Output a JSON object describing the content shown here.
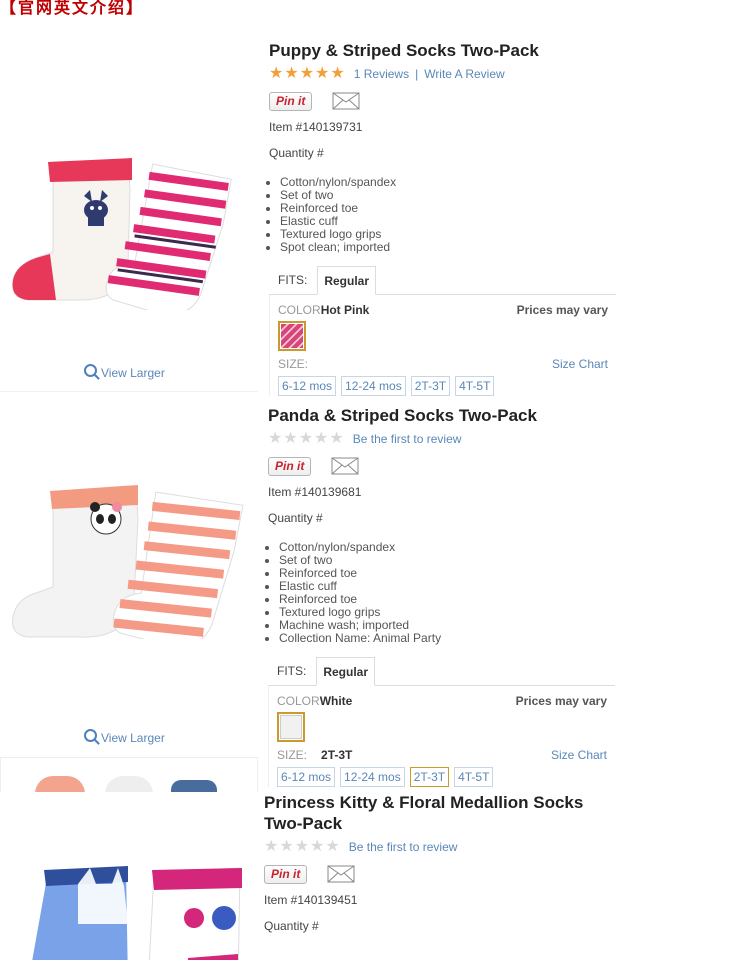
{
  "banner": "【官网英文介绍】",
  "colors": {
    "link": "#5a87b8",
    "star": "#f2a13a",
    "pin": "#c8232c",
    "selected_border": "#c99a2e"
  },
  "products": [
    {
      "title": "Puppy & Striped Socks Two-Pack",
      "rating": 5,
      "reviews_link": "1 Reviews",
      "separator": "|",
      "write_review": "Write A Review",
      "pin_label": "Pin it",
      "item_number": "Item #140139731",
      "quantity_label": "Quantity #",
      "features": [
        "Cotton/nylon/spandex",
        "Set of two",
        "Reinforced toe",
        "Elastic cuff",
        "Textured logo grips",
        "Spot clean; imported"
      ],
      "fits_label": "FITS:",
      "fit_tab": "Regular",
      "color_label": "COLOR",
      "color_value": "Hot Pink",
      "prices_note": "Prices may vary",
      "size_label": "SIZE:",
      "size_selected": "",
      "size_chart": "Size Chart",
      "sizes": [
        "6-12 mos",
        "12-24 mos",
        "2T-3T",
        "4T-5T"
      ],
      "view_larger": "View Larger",
      "swatch_color": "#d8457a"
    },
    {
      "title": "Panda & Striped Socks Two-Pack",
      "rating": 0,
      "first_review": "Be the first to review",
      "pin_label": "Pin it",
      "item_number": "Item #140139681",
      "quantity_label": "Quantity #",
      "features": [
        "Cotton/nylon/spandex",
        "Set of two",
        "Reinforced toe",
        "Elastic cuff",
        "Reinforced toe",
        "Textured logo grips",
        "Machine wash; imported",
        "Collection Name: Animal Party"
      ],
      "fits_label": "FITS:",
      "fit_tab": "Regular",
      "color_label": "COLOR",
      "color_value": "White",
      "prices_note": "Prices may vary",
      "size_label": "SIZE:",
      "size_selected": "2T-3T",
      "size_chart": "Size Chart",
      "sizes": [
        "6-12 mos",
        "12-24 mos",
        "2T-3T",
        "4T-5T"
      ],
      "view_larger": "View Larger",
      "swatch_color": "#f4f4f4"
    },
    {
      "title": "Princess Kitty & Floral Medallion Socks Two-Pack",
      "rating": 0,
      "first_review": "Be the first to review",
      "pin_label": "Pin it",
      "item_number": "Item #140139451",
      "quantity_label": "Quantity #"
    }
  ]
}
